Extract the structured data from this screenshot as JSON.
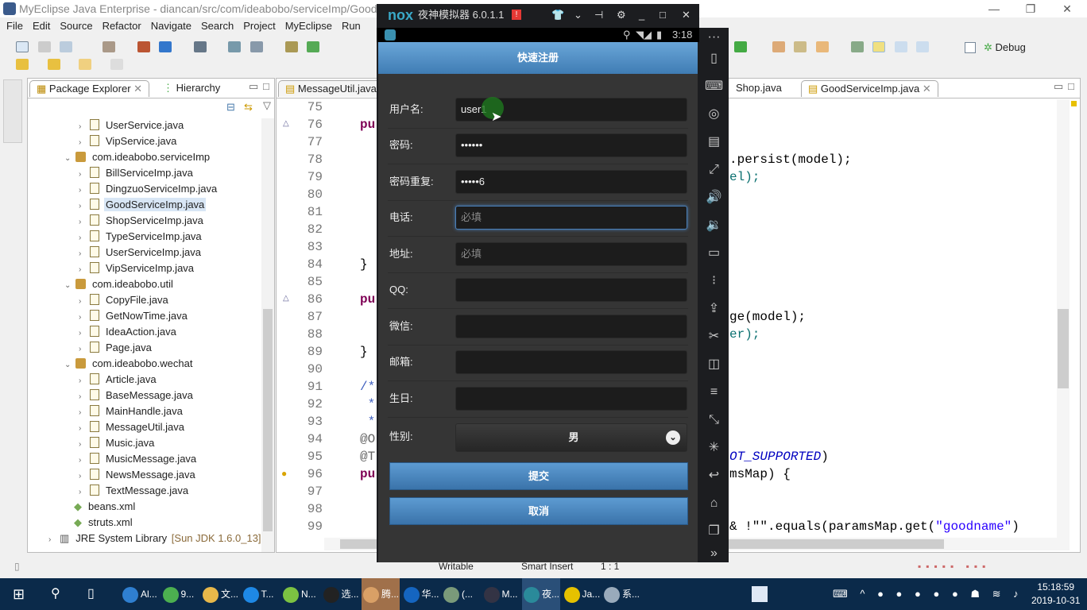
{
  "window": {
    "title": "MyEclipse Java Enterprise - diancan/src/com/ideabobo/serviceImp/GoodServ"
  },
  "menu": [
    "File",
    "Edit",
    "Source",
    "Refactor",
    "Navigate",
    "Search",
    "Project",
    "MyEclipse",
    "Run"
  ],
  "toolbar": {
    "perspective_debug": "Debug"
  },
  "package_explorer": {
    "tabs": [
      "Package Explorer",
      "Hierarchy"
    ],
    "items": [
      {
        "label": "UserService.java",
        "type": "file"
      },
      {
        "label": "VipService.java",
        "type": "file"
      },
      {
        "label": "com.ideabobo.serviceImp",
        "type": "package"
      },
      {
        "label": "BillServiceImp.java",
        "type": "file"
      },
      {
        "label": "DingzuoServiceImp.java",
        "type": "file"
      },
      {
        "label": "GoodServiceImp.java",
        "type": "file",
        "selected": true
      },
      {
        "label": "ShopServiceImp.java",
        "type": "file"
      },
      {
        "label": "TypeServiceImp.java",
        "type": "file"
      },
      {
        "label": "UserServiceImp.java",
        "type": "file"
      },
      {
        "label": "VipServiceImp.java",
        "type": "file"
      },
      {
        "label": "com.ideabobo.util",
        "type": "package"
      },
      {
        "label": "CopyFile.java",
        "type": "file"
      },
      {
        "label": "GetNowTime.java",
        "type": "file"
      },
      {
        "label": "IdeaAction.java",
        "type": "file"
      },
      {
        "label": "Page.java",
        "type": "file"
      },
      {
        "label": "com.ideabobo.wechat",
        "type": "package"
      },
      {
        "label": "Article.java",
        "type": "file"
      },
      {
        "label": "BaseMessage.java",
        "type": "file"
      },
      {
        "label": "MainHandle.java",
        "type": "file"
      },
      {
        "label": "MessageUtil.java",
        "type": "file"
      },
      {
        "label": "Music.java",
        "type": "file"
      },
      {
        "label": "MusicMessage.java",
        "type": "file"
      },
      {
        "label": "NewsMessage.java",
        "type": "file"
      },
      {
        "label": "TextMessage.java",
        "type": "file"
      },
      {
        "label": "beans.xml",
        "type": "xml"
      },
      {
        "label": "struts.xml",
        "type": "xml"
      },
      {
        "label": "JRE System Library",
        "type": "lib",
        "suffix": "[Sun JDK 1.6.0_13]"
      }
    ]
  },
  "editor": {
    "tabs": [
      "MessageUtil.java",
      "Shop.java",
      "GoodServiceImp.java"
    ],
    "active_tab": "GoodServiceImp.java",
    "line_numbers": [
      "75",
      "76",
      "77",
      "78",
      "79",
      "80",
      "81",
      "82",
      "83",
      "84",
      "85",
      "86",
      "87",
      "88",
      "89",
      "90",
      "91",
      "92",
      "93",
      "94",
      "95",
      "96",
      "97",
      "98",
      "99"
    ],
    "left_fragments": {
      "76": "pu",
      "84": "}",
      "86": "pu",
      "89": "}",
      "91": "/*",
      "92": " *",
      "93": " *",
      "94": "@O",
      "95": "@T",
      "96": "pu"
    },
    "right_fragments": {
      "78": ".persist(model);",
      "79": "el);",
      "87": "ge(model);",
      "88": "er);",
      "95a": "OT_SUPPORTED",
      "95b": ")",
      "96": "msMap) {",
      "99a": "& !\"\".equals(paramsMap.get(",
      "99b": "\"goodname\"",
      "99c": ")"
    }
  },
  "status": {
    "writable": "Writable",
    "insert_mode": "Smart Insert",
    "position": "1 : 1"
  },
  "nox": {
    "title": "夜神模拟器 6.0.1.1",
    "logo": "nox",
    "time": "3:18",
    "app_title": "快速注册",
    "form": [
      {
        "label": "用户名:",
        "value": "user1"
      },
      {
        "label": "密码:",
        "value": "••••••"
      },
      {
        "label": "密码重复:",
        "value": "•••••6"
      },
      {
        "label": "电话:",
        "placeholder": "必填",
        "focused": true
      },
      {
        "label": "地址:",
        "placeholder": "必填"
      },
      {
        "label": "QQ:",
        "value": ""
      },
      {
        "label": "微信:",
        "value": ""
      },
      {
        "label": "邮箱:",
        "value": ""
      },
      {
        "label": "生日:",
        "value": ""
      }
    ],
    "gender": {
      "label": "性别:",
      "value": "男"
    },
    "submit": "提交",
    "cancel": "取消"
  },
  "taskbar": {
    "items": [
      {
        "label": "Al...",
        "color": "#2f7fd0"
      },
      {
        "label": "9...",
        "color": "#4caf50"
      },
      {
        "label": "文...",
        "color": "#e8b84a"
      },
      {
        "label": "T...",
        "color": "#1e88e5"
      },
      {
        "label": "N...",
        "color": "#7cc242"
      },
      {
        "label": "选...",
        "color": "#222"
      },
      {
        "label": "腾...",
        "color": "#d9a066",
        "active": true
      },
      {
        "label": "华...",
        "color": "#1565c0"
      },
      {
        "label": "(...",
        "color": "#7a9a7a"
      },
      {
        "label": "M...",
        "color": "#334"
      },
      {
        "label": "夜...",
        "color": "#2a8a9a",
        "active": true
      },
      {
        "label": "Ja...",
        "color": "#e5c100"
      },
      {
        "label": "系...",
        "color": "#9ab"
      }
    ],
    "time": "15:18:59",
    "date": "2019-10-31"
  }
}
